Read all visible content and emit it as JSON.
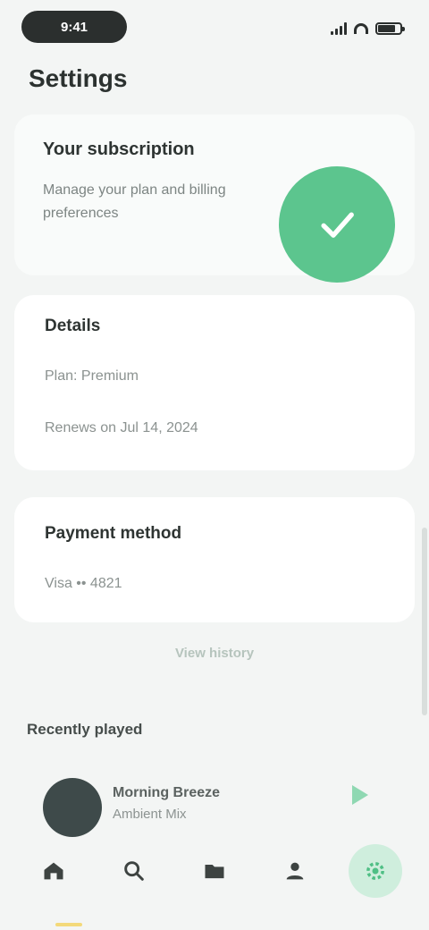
{
  "status_bar": {
    "time": "9:41"
  },
  "page": {
    "title": "Settings"
  },
  "hero": {
    "title": "Your subscription",
    "text": "Manage your plan and billing preferences",
    "icon": "check-icon"
  },
  "details": {
    "heading": "Details",
    "line1": "Plan: Premium",
    "line2": "Renews on Jul 14, 2024"
  },
  "payment": {
    "heading": "Payment method",
    "line1": "Visa •• 4821"
  },
  "link": {
    "label": "View history"
  },
  "section": {
    "title": "Recently played"
  },
  "mini_player": {
    "title": "Morning Breeze",
    "subtitle": "Ambient Mix"
  },
  "nav": {
    "items": [
      {
        "name": "home",
        "icon": "home-icon"
      },
      {
        "name": "search",
        "icon": "search-icon"
      },
      {
        "name": "library",
        "icon": "folder-icon"
      },
      {
        "name": "profile",
        "icon": "user-icon"
      },
      {
        "name": "settings",
        "icon": "gear-icon"
      }
    ]
  },
  "colors": {
    "accent": "#5cc58e",
    "accent_soft": "#cfeedd",
    "background": "#f3f5f4"
  }
}
